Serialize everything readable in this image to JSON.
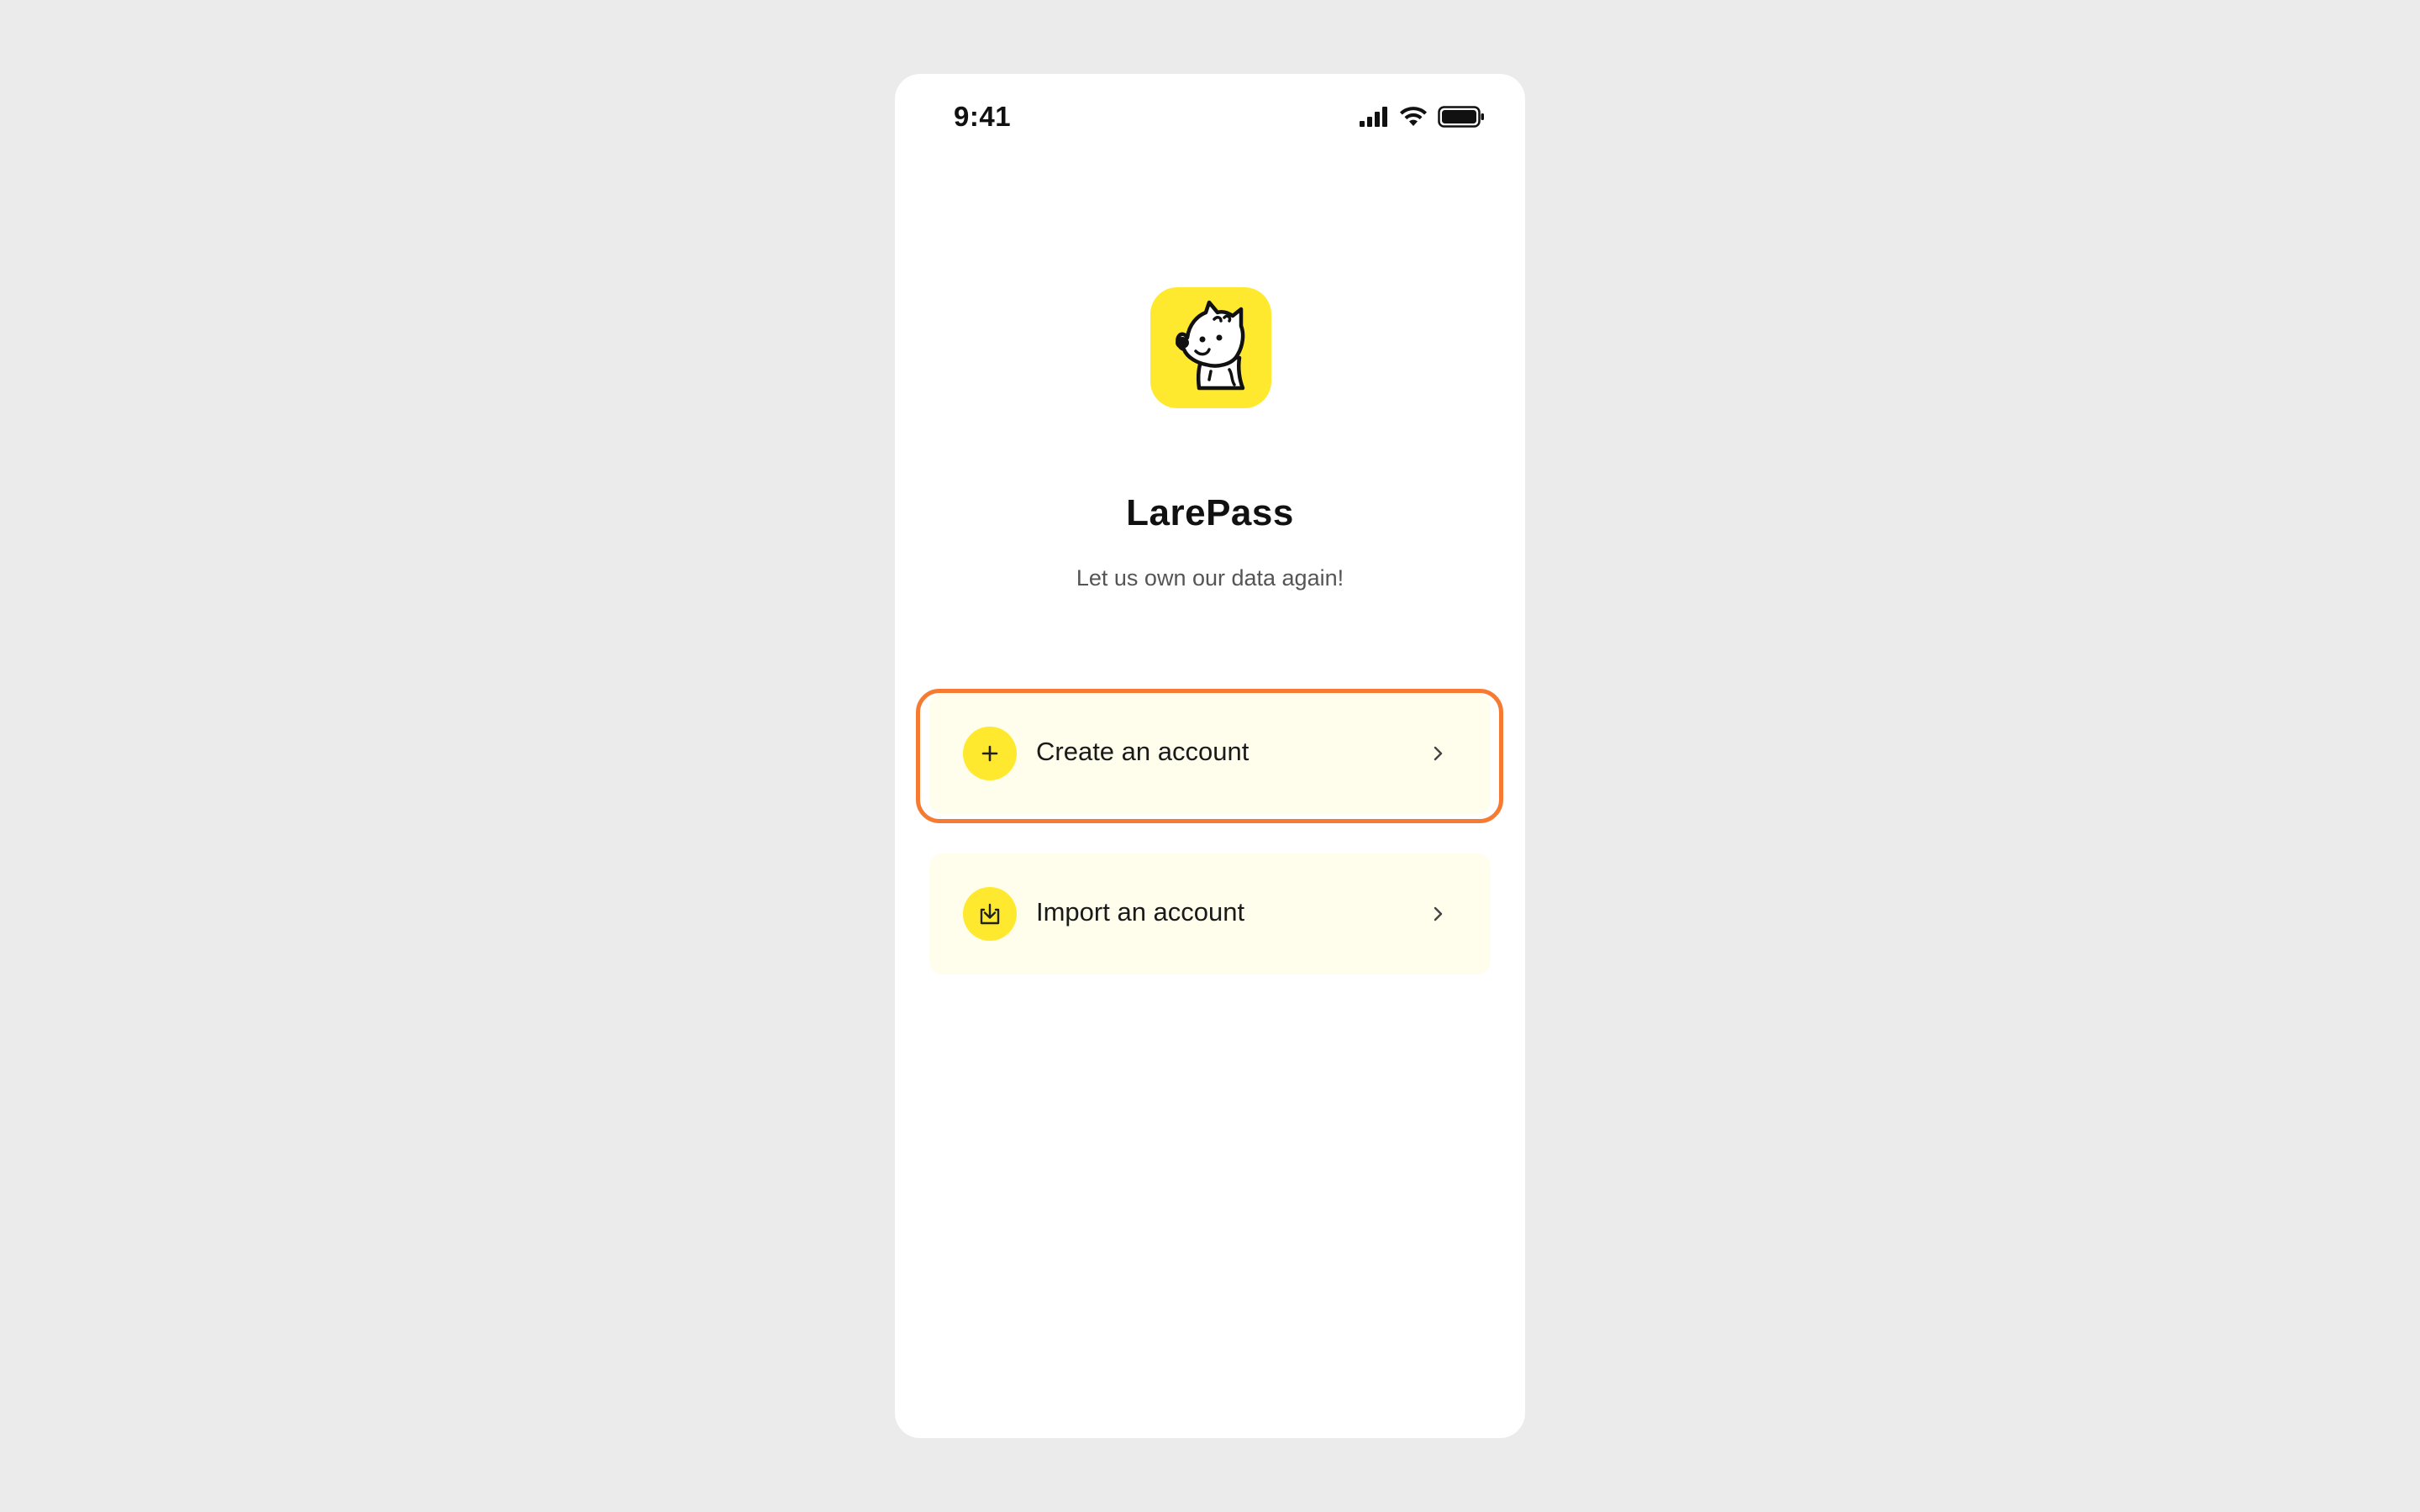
{
  "status_bar": {
    "time": "9:41",
    "icons": [
      "cellular-signal-icon",
      "wifi-icon",
      "battery-icon"
    ]
  },
  "app": {
    "name": "LarePass",
    "tagline": "Let us own our data again!",
    "logo_icon": "larepass-dog-logo",
    "accent_color": "#ffe92e",
    "card_background": "#fffdeb",
    "highlight_color": "#f77a33"
  },
  "options": {
    "create": {
      "label": "Create an account",
      "icon": "plus-icon",
      "chevron": "chevron-right-icon"
    },
    "import": {
      "label": "Import an account",
      "icon": "import-icon",
      "chevron": "chevron-right-icon"
    }
  }
}
